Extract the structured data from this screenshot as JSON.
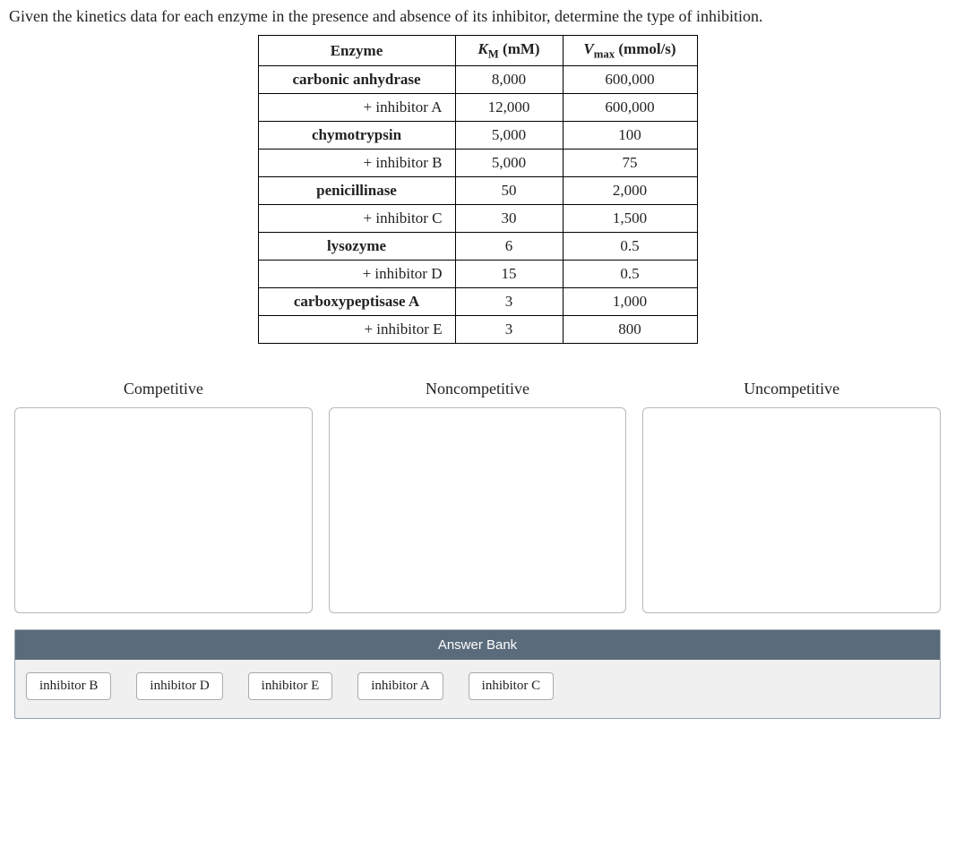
{
  "prompt": "Given the kinetics data for each enzyme in the presence and absence of its inhibitor, determine the type of inhibition.",
  "table": {
    "headers": {
      "enzyme": "Enzyme",
      "km_html": "<em class='var'>K</em><sub>M</sub> (mM)",
      "vmax_html": "<em class='var'>V</em><sub>max</sub> (mmol/s)"
    },
    "rows": [
      {
        "enzyme": "carbonic anhydrase",
        "km": "8,000",
        "vmax": "600,000",
        "bold": true
      },
      {
        "enzyme": "+ inhibitor A",
        "km": "12,000",
        "vmax": "600,000",
        "bold": false
      },
      {
        "enzyme": "chymotrypsin",
        "km": "5,000",
        "vmax": "100",
        "bold": true
      },
      {
        "enzyme": "+ inhibitor B",
        "km": "5,000",
        "vmax": "75",
        "bold": false
      },
      {
        "enzyme": "penicillinase",
        "km": "50",
        "vmax": "2,000",
        "bold": true
      },
      {
        "enzyme": "+ inhibitor C",
        "km": "30",
        "vmax": "1,500",
        "bold": false
      },
      {
        "enzyme": "lysozyme",
        "km": "6",
        "vmax": "0.5",
        "bold": true
      },
      {
        "enzyme": "+ inhibitor D",
        "km": "15",
        "vmax": "0.5",
        "bold": false
      },
      {
        "enzyme": "carboxypeptisase A",
        "km": "3",
        "vmax": "1,000",
        "bold": true
      },
      {
        "enzyme": "+ inhibitor E",
        "km": "3",
        "vmax": "800",
        "bold": false
      }
    ]
  },
  "drop_zones": [
    {
      "label": "Competitive"
    },
    {
      "label": "Noncompetitive"
    },
    {
      "label": "Uncompetitive"
    }
  ],
  "answer_bank": {
    "title": "Answer Bank",
    "chips": [
      "inhibitor B",
      "inhibitor D",
      "inhibitor E",
      "inhibitor A",
      "inhibitor C"
    ]
  }
}
